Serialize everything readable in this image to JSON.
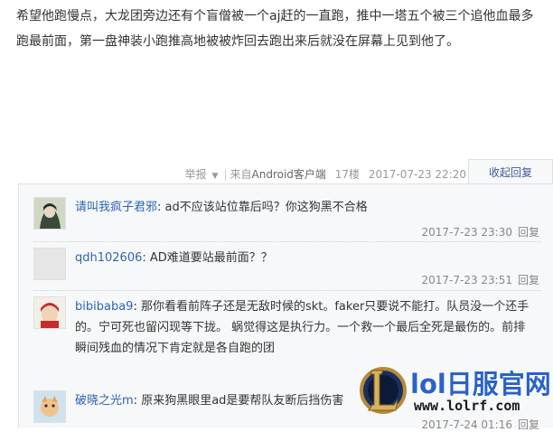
{
  "post": {
    "text": "希望他跑慢点，大龙团旁边还有个盲僧被一个aj赶的一直跑，推中一塔五个被三个追他血最多跑最前面，第一盘神装小跑推高地被被炸回去跑出来后就没在屏幕上见到他了。",
    "report_label": "举报",
    "source_prefix": "来自",
    "source_name": "Android客户端",
    "floor": "17楼",
    "datetime": "2017-07-23 22:20",
    "collapse_label": "收起回复"
  },
  "replies": [
    {
      "user": "请叫我疯子君邪",
      "content": "ad不应该站位靠后吗？你这狗黑不合格",
      "time": "2017-7-23 23:30",
      "reply_label": "回复"
    },
    {
      "user": "qdh102606",
      "content": "AD难道要站最前面？？",
      "time": "2017-7-23 23:51",
      "reply_label": "回复"
    },
    {
      "user": "bibibaba9",
      "content": "那你看看前阵子还是无敌时候的skt。faker只要说不能打。队员没一个还手的。宁可死也留闪现等下拢。 蜗觉得这是执行力。一个救一个最后全死是最伤的。前排瞬间残血的情况下肯定就是各自跑的团",
      "time": "",
      "reply_label": ""
    },
    {
      "user": "破晓之光m",
      "content": "原来狗黑眼里ad是要帮队友断后挡伤害",
      "time": "2017-7-24 01:16",
      "reply_label": "回复"
    }
  ],
  "watermark": {
    "title": "lol日服官网",
    "url": "www.lolrf.com"
  },
  "colors": {
    "link": "#2d64b3",
    "meta": "#999999",
    "comment_bg": "#f7f8fa",
    "watermark_blue": "#2a63c7"
  }
}
